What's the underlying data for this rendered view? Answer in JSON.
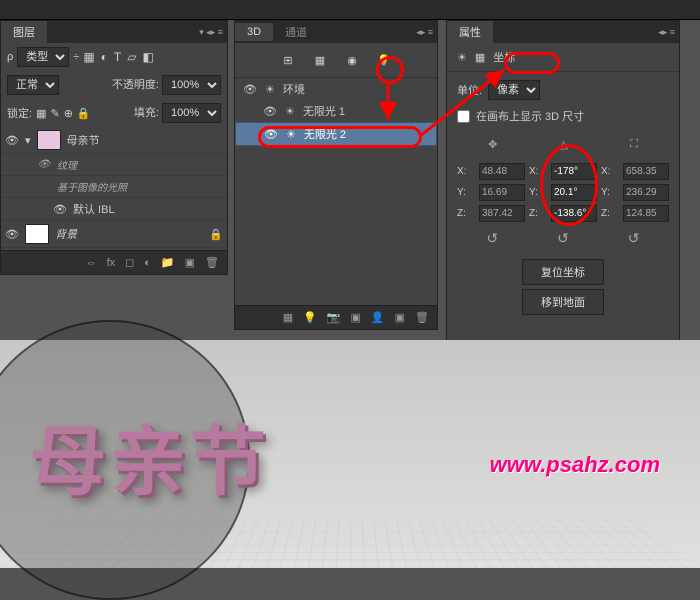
{
  "panels": {
    "layers": {
      "tab": "图层",
      "typeLabel": "类型",
      "blend": "正常",
      "opacityLabel": "不透明度:",
      "opacityValue": "100%",
      "lockLabel": "锁定:",
      "fillLabel": "填充:",
      "fillValue": "100%",
      "items": {
        "main": "母亲节",
        "texture": "纹理",
        "ibl_note": "基于图像的光照",
        "ibl": "默认 IBL",
        "background": "背景"
      }
    },
    "threeD": {
      "tabs": [
        "3D",
        "通道"
      ],
      "environment": "环境",
      "lights": [
        "无限光 1",
        "无限光 2"
      ]
    },
    "properties": {
      "tab": "属性",
      "coordsTab": "坐标",
      "unitsLabel": "单位:",
      "unitsValue": "像素",
      "checkbox": "在画布上显示 3D 尺寸",
      "pos": {
        "x": "48.48",
        "y": "16.69",
        "z": "387.42"
      },
      "rot": {
        "x": "-178°",
        "y": "20.1°",
        "z": "-138.6°"
      },
      "scale": {
        "x": "658.35",
        "y": "236.29",
        "z": "124.85"
      },
      "resetBtn": "复位坐标",
      "groundBtn": "移到地面"
    }
  },
  "viewport": {
    "text3d": "母亲节",
    "watermark": "www.psahz.com"
  }
}
